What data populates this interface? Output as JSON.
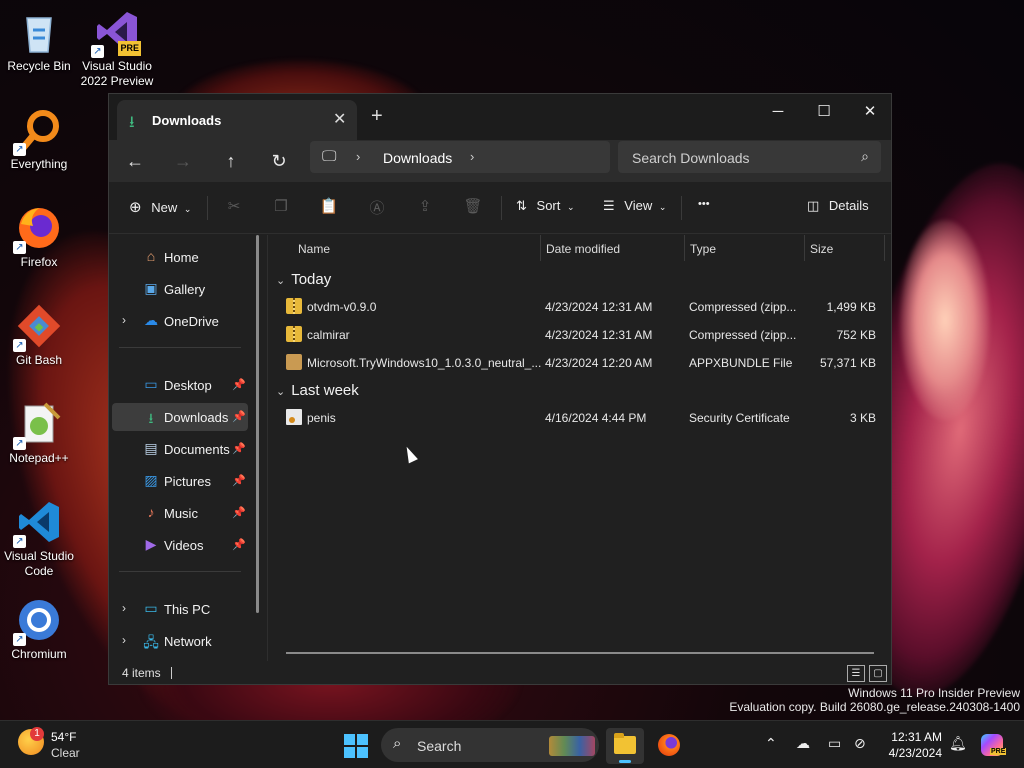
{
  "desktop": {
    "icons": [
      {
        "label": "Recycle Bin",
        "icon": "recycle-bin-icon"
      },
      {
        "label": "Visual Studio 2022 Preview",
        "icon": "visual-studio-icon",
        "badge": "PRE"
      },
      {
        "label": "Everything",
        "icon": "magnifier-icon"
      },
      {
        "label": "Firefox",
        "icon": "firefox-icon"
      },
      {
        "label": "Git Bash",
        "icon": "git-icon"
      },
      {
        "label": "Notepad++",
        "icon": "notepad-plus-plus-icon"
      },
      {
        "label": "Visual Studio Code",
        "icon": "vscode-icon"
      },
      {
        "label": "Chromium",
        "icon": "chromium-icon"
      }
    ],
    "shortcut_glyph": "↗"
  },
  "window": {
    "tab_title": "Downloads",
    "new_tab": "+",
    "controls": {
      "minimize": "─",
      "maximize": "☐",
      "close": "✕"
    },
    "nav": {
      "back": "←",
      "forward": "→",
      "up": "↑",
      "refresh": "↻"
    },
    "address": {
      "crumb": "Downloads",
      "chevron": "›"
    },
    "search_placeholder": "Search Downloads",
    "toolbar": {
      "new_label": "New",
      "sort_label": "Sort",
      "view_label": "View",
      "more_label": "•••",
      "details_label": "Details"
    },
    "sidebar": {
      "home": "Home",
      "gallery": "Gallery",
      "onedrive": "OneDrive",
      "desktop": "Desktop",
      "downloads": "Downloads",
      "documents": "Documents",
      "pictures": "Pictures",
      "music": "Music",
      "videos": "Videos",
      "this_pc": "This PC",
      "network": "Network"
    },
    "columns": {
      "name": "Name",
      "date": "Date modified",
      "type": "Type",
      "size": "Size"
    },
    "groups": {
      "today": "Today",
      "last_week": "Last week"
    },
    "files": [
      {
        "name": "otvdm-v0.9.0",
        "date": "4/23/2024 12:31 AM",
        "type": "Compressed (zipp...",
        "size": "1,499 KB",
        "kind": "zip"
      },
      {
        "name": "calmirar",
        "date": "4/23/2024 12:31 AM",
        "type": "Compressed (zipp...",
        "size": "752 KB",
        "kind": "zip"
      },
      {
        "name": "Microsoft.TryWindows10_1.0.3.0_neutral_...",
        "date": "4/23/2024 12:20 AM",
        "type": "APPXBUNDLE File",
        "size": "57,371 KB",
        "kind": "package"
      },
      {
        "name": "penis",
        "date": "4/16/2024 4:44 PM",
        "type": "Security Certificate",
        "size": "3 KB",
        "kind": "certificate"
      }
    ],
    "status": "4 items"
  },
  "watermark": {
    "line1": "Windows 11 Pro Insider Preview",
    "line2": "Evaluation copy. Build 26080.ge_release.240308-1400"
  },
  "taskbar": {
    "weather_temp": "54°F",
    "weather_cond": "Clear",
    "weather_badge": "1",
    "search_label": "Search",
    "time": "12:31 AM",
    "date": "4/23/2024",
    "copilot_badge": "PRE",
    "accent": "#4cc2ff"
  }
}
